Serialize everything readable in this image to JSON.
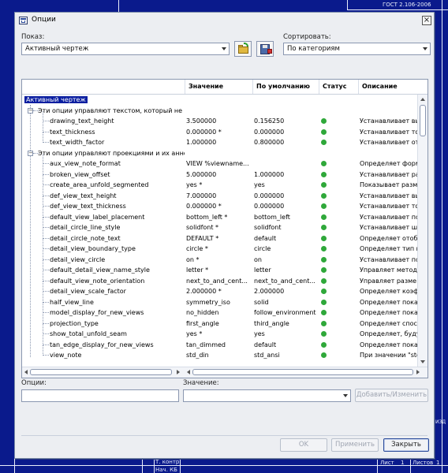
{
  "cad": {
    "stamp_top": "ГОСТ 2.106-2006",
    "bottom_labels": [
      "Т. контр",
      "Нач. КБ"
    ],
    "sheet_label": "Лист",
    "sheet_num": "1",
    "sheets_label": "Листов",
    "sheets_num": "1",
    "side_text": "ИЗД"
  },
  "dialog": {
    "title": "Опции",
    "close": "×",
    "show_label": "Показ:",
    "show_value": "Активный чертеж",
    "sort_label": "Сортировать:",
    "sort_value": "По категориям",
    "option_label": "Опции:",
    "value_label": "Значение:",
    "option_value": "",
    "value_value": "",
    "add_change": "Добавить/Изменить",
    "ok": "OK",
    "apply": "Применить",
    "close_btn": "Закрыть"
  },
  "table": {
    "headers": [
      "",
      "Значение",
      "По умолчанию",
      "Статус",
      "Описание"
    ],
    "status_color": "#2fa83a",
    "selection_color": "#0a1ea0",
    "root": "Активный чертеж",
    "groups": [
      {
        "label": "Эти опции управляют текстом, который не п"
      },
      {
        "label": "Эти опции управляют проекциями и их аннот"
      }
    ],
    "rows": [
      {
        "kind": "root",
        "name": "Активный чертеж"
      },
      {
        "kind": "group",
        "name": "Эти опции управляют текстом, который не п"
      },
      {
        "kind": "item",
        "name": "drawing_text_height",
        "value": "3.500000",
        "default": "0.156250",
        "desc": "Устанавливает вы"
      },
      {
        "kind": "item",
        "name": "text_thickness",
        "value": "0.000000 *",
        "default": "0.000000",
        "desc": "Устанавливает то"
      },
      {
        "kind": "item",
        "name": "text_width_factor",
        "value": "1.000000",
        "default": "0.800000",
        "desc": "Устанавливает от"
      },
      {
        "kind": "group",
        "name": "Эти опции управляют проекциями и их аннот"
      },
      {
        "kind": "item",
        "name": "aux_view_note_format",
        "value": "VIEW %viewname...",
        "default": "",
        "desc": "Определяет форм"
      },
      {
        "kind": "item",
        "name": "broken_view_offset",
        "value": "5.000000",
        "default": "1.000000",
        "desc": "Устанавливает ра"
      },
      {
        "kind": "item",
        "name": "create_area_unfold_segmented",
        "value": "yes *",
        "default": "yes",
        "desc": "Показывает разм"
      },
      {
        "kind": "item",
        "name": "def_view_text_height",
        "value": "7.000000",
        "default": "0.000000",
        "desc": "Устанавливает вы"
      },
      {
        "kind": "item",
        "name": "def_view_text_thickness",
        "value": "0.000000 *",
        "default": "0.000000",
        "desc": "Устанавливает то"
      },
      {
        "kind": "item",
        "name": "default_view_label_placement",
        "value": "bottom_left *",
        "default": "bottom_left",
        "desc": "Устанавливает по"
      },
      {
        "kind": "item",
        "name": "detail_circle_line_style",
        "value": "solidfont *",
        "default": "solidfont",
        "desc": "Устанавливает ши"
      },
      {
        "kind": "item",
        "name": "detail_circle_note_text",
        "value": "DEFAULT *",
        "default": "default",
        "desc": "Определяет отобр"
      },
      {
        "kind": "item",
        "name": "detail_view_boundary_type",
        "value": "circle *",
        "default": "circle",
        "desc": "Определяет тип г"
      },
      {
        "kind": "item",
        "name": "detail_view_circle",
        "value": "on *",
        "default": "on",
        "desc": "Устанавливает по"
      },
      {
        "kind": "item",
        "name": "default_detail_view_name_style",
        "value": "letter *",
        "default": "letter",
        "desc": "Управляет методо"
      },
      {
        "kind": "item",
        "name": "default_view_note_orientation",
        "value": "next_to_and_cent...",
        "default": "next_to_and_cent...",
        "desc": "Управляет разме"
      },
      {
        "kind": "item",
        "name": "detail_view_scale_factor",
        "value": "2.000000 *",
        "default": "2.000000",
        "desc": "Определяет коэф"
      },
      {
        "kind": "item",
        "name": "half_view_line",
        "value": "symmetry_iso",
        "default": "solid",
        "desc": "Определяет пока"
      },
      {
        "kind": "item",
        "name": "model_display_for_new_views",
        "value": "no_hidden",
        "default": "follow_environment",
        "desc": "Определяет пока"
      },
      {
        "kind": "item",
        "name": "projection_type",
        "value": "first_angle",
        "default": "third_angle",
        "desc": "Определяет спос"
      },
      {
        "kind": "item",
        "name": "show_total_unfold_seam",
        "value": "yes *",
        "default": "yes",
        "desc": "Определяет, буду"
      },
      {
        "kind": "item",
        "name": "tan_edge_display_for_new_views",
        "value": "tan_dimmed",
        "default": "default",
        "desc": "Определяет пока"
      },
      {
        "kind": "item",
        "name": "view_note",
        "value": "std_din",
        "default": "std_ansi",
        "desc": "При значении \"std"
      }
    ]
  }
}
